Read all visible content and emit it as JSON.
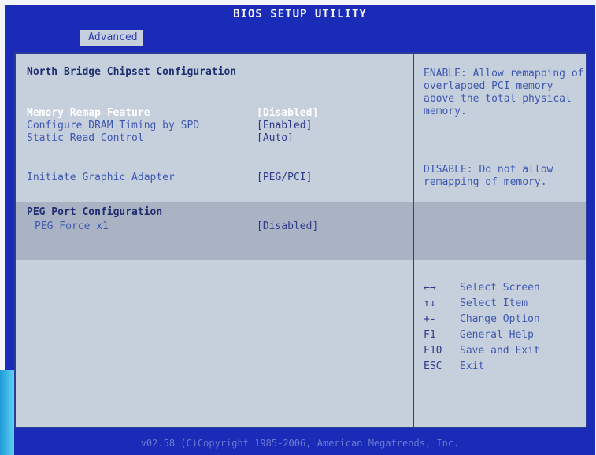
{
  "header": {
    "title": "BIOS SETUP UTILITY",
    "active_tab": "Advanced"
  },
  "left": {
    "section_title": "North Bridge Chipset Configuration",
    "items": [
      {
        "label": "Memory Remap Feature",
        "value": "[Disabled]"
      },
      {
        "label": "Configure DRAM Timing by SPD",
        "value": "[Enabled]"
      },
      {
        "label": "Static Read Control",
        "value": "[Auto]"
      },
      {
        "label": "Initiate Graphic Adapter",
        "value": "[PEG/PCI]"
      }
    ],
    "peg_title": "PEG Port Configuration",
    "peg_items": [
      {
        "label": "PEG Force x1",
        "value": "[Disabled]"
      }
    ]
  },
  "right": {
    "help_enable": "ENABLE: Allow remapping of overlapped PCI memory above the total physical memory.",
    "help_disable": "DISABLE: Do not allow remapping of memory.",
    "keys": [
      {
        "key": "←→",
        "desc": "Select Screen"
      },
      {
        "key": "↑↓",
        "desc": "Select Item"
      },
      {
        "key": "+-",
        "desc": "Change Option"
      },
      {
        "key": "F1",
        "desc": "General Help"
      },
      {
        "key": "F10",
        "desc": "Save and Exit"
      },
      {
        "key": "ESC",
        "desc": "Exit"
      }
    ]
  },
  "footer": {
    "text": "v02.58 (C)Copyright 1985-2006, American Megatrends, Inc."
  }
}
